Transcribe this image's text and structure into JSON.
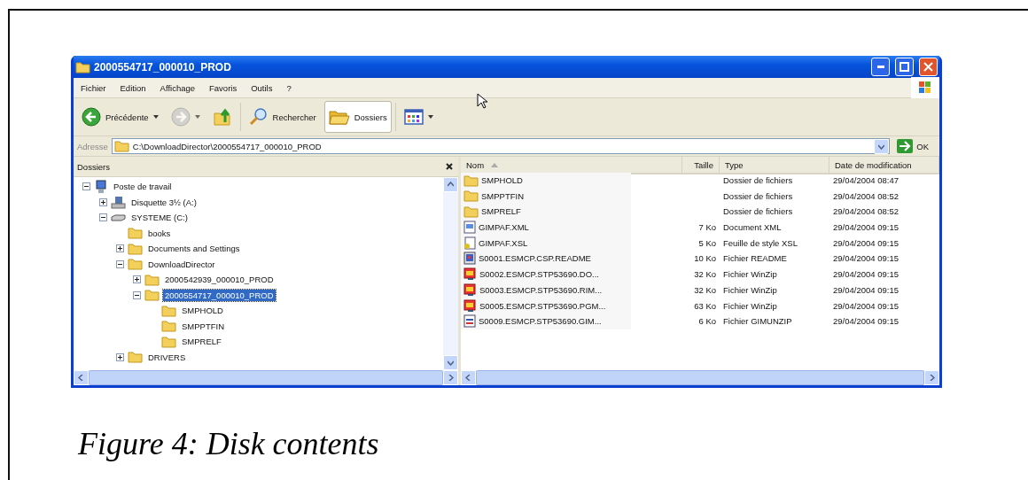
{
  "window": {
    "title": "2000554717_000010_PROD"
  },
  "menu": [
    "Fichier",
    "Edition",
    "Affichage",
    "Favoris",
    "Outils",
    "?"
  ],
  "toolbar": [
    {
      "kind": "back",
      "label": "Précédente",
      "dropdown": true,
      "disabled": false,
      "pressed": false
    },
    {
      "kind": "forward",
      "dropdown": true,
      "disabled": true,
      "pressed": false
    },
    {
      "kind": "up",
      "dropdown": false,
      "disabled": false,
      "pressed": false
    },
    {
      "kind": "search",
      "label": "Rechercher",
      "dropdown": false,
      "disabled": false,
      "pressed": false
    },
    {
      "kind": "folders",
      "label": "Dossiers",
      "dropdown": false,
      "disabled": false,
      "pressed": true
    },
    {
      "kind": "views",
      "dropdown": true,
      "disabled": false,
      "pressed": false
    }
  ],
  "address": {
    "label": "Adresse",
    "value": "C:\\DownloadDirector\\2000554717_000010_PROD",
    "go": "OK"
  },
  "folders_pane": {
    "title": "Dossiers",
    "tree": [
      {
        "label": "Poste de travail",
        "kind": "computer",
        "expanded": true,
        "selected": false,
        "children": [
          {
            "label": "Disquette 3½ (A:)",
            "kind": "floppy",
            "expanded": false,
            "selected": false
          },
          {
            "label": "SYSTEME (C:)",
            "kind": "drive",
            "expanded": true,
            "selected": false,
            "children": [
              {
                "label": "books",
                "kind": "folder",
                "selected": false
              },
              {
                "label": "Documents and Settings",
                "kind": "folder",
                "expanded": false,
                "selected": false
              },
              {
                "label": "DownloadDirector",
                "kind": "folder",
                "expanded": true,
                "selected": false,
                "children": [
                  {
                    "label": "2000542939_000010_PROD",
                    "kind": "folder",
                    "expanded": false,
                    "selected": false
                  },
                  {
                    "label": "2000554717_000010_PROD",
                    "kind": "folder",
                    "expanded": true,
                    "selected": true,
                    "children": [
                      {
                        "label": "SMPHOLD",
                        "kind": "folder",
                        "selected": false
                      },
                      {
                        "label": "SMPPTFIN",
                        "kind": "folder",
                        "selected": false
                      },
                      {
                        "label": "SMPRELF",
                        "kind": "folder",
                        "selected": false
                      }
                    ]
                  }
                ]
              },
              {
                "label": "DRIVERS",
                "kind": "folder",
                "expanded": false,
                "selected": false
              }
            ]
          }
        ]
      }
    ]
  },
  "file_list": {
    "columns": [
      {
        "label": "Nom",
        "sorted": true
      },
      {
        "label": "Taille",
        "sorted": false
      },
      {
        "label": "Type",
        "sorted": false
      },
      {
        "label": "Date de modification",
        "sorted": false
      }
    ],
    "rows": [
      {
        "kind": "folder",
        "name": "SMPHOLD",
        "type": "Dossier de fichiers",
        "date": "29/04/2004 08:47"
      },
      {
        "kind": "folder",
        "name": "SMPPTFIN",
        "type": "Dossier de fichiers",
        "date": "29/04/2004 08:52"
      },
      {
        "kind": "folder",
        "name": "SMPRELF",
        "type": "Dossier de fichiers",
        "date": "29/04/2004 08:52"
      },
      {
        "kind": "xml",
        "name": "GIMPAF.XML",
        "size": "7 Ko",
        "type": "Document XML",
        "date": "29/04/2004 09:15"
      },
      {
        "kind": "xsl",
        "name": "GIMPAF.XSL",
        "size": "5 Ko",
        "type": "Feuille de style XSL",
        "date": "29/04/2004 09:15"
      },
      {
        "kind": "readme",
        "name": "S0001.ESMCP.CSP.README",
        "size": "10 Ko",
        "type": "Fichier README",
        "date": "29/04/2004 09:15"
      },
      {
        "kind": "zip",
        "name": "S0002.ESMCP.STP53690.DO...",
        "size": "32 Ko",
        "type": "Fichier WinZip",
        "date": "29/04/2004 09:15"
      },
      {
        "kind": "zip",
        "name": "S0003.ESMCP.STP53690.RIM...",
        "size": "32 Ko",
        "type": "Fichier WinZip",
        "date": "29/04/2004 09:15"
      },
      {
        "kind": "zip",
        "name": "S0005.ESMCP.STP53690.PGM...",
        "size": "63 Ko",
        "type": "Fichier WinZip",
        "date": "29/04/2004 09:15"
      },
      {
        "kind": "doc",
        "name": "S0009.ESMCP.STP53690.GIM...",
        "size": "6 Ko",
        "type": "Fichier GIMUNZIP",
        "date": "29/04/2004 09:15"
      }
    ]
  },
  "caption": "Figure 4: Disk contents"
}
